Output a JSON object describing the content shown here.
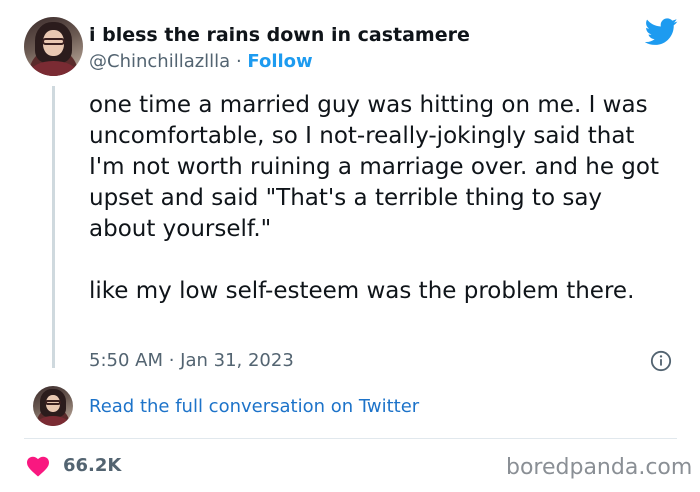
{
  "author": {
    "display_name": "i bless the rains down in castamere",
    "handle": "@Chinchillazllla",
    "separator": " · ",
    "follow_label": "Follow"
  },
  "tweet": {
    "text": "one time a married guy was hitting on me. I was uncomfortable, so I not-really-jokingly said that I'm not worth ruining a marriage over. and he got upset and said \"That's a terrible thing to say about yourself.\"\n\nlike my low self-esteem was the problem there.",
    "timestamp": "5:50 AM · Jan 31, 2023"
  },
  "conversation_link": "Read the full conversation on Twitter",
  "likes": "66.2K",
  "watermark": "boredpanda.com",
  "icons": {
    "brand": "twitter-bird-icon",
    "info": "info-icon",
    "like": "heart-icon"
  },
  "colors": {
    "twitter_blue": "#1d9bf0",
    "link_blue": "#1d73c9",
    "heart_pink": "#f91880",
    "muted_text": "#536471"
  }
}
